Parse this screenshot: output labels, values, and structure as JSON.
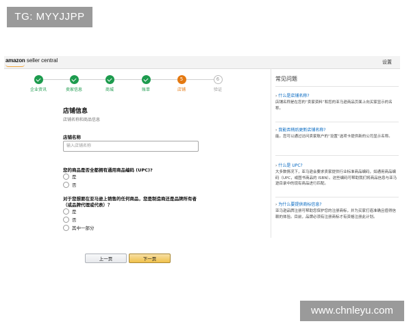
{
  "watermarks": {
    "top": "TG: MYYJJPP",
    "bottom": "www.chnleyu.com"
  },
  "header": {
    "logo_bold": "amazon",
    "logo_rest": " seller central",
    "settings": "设置"
  },
  "steps": [
    {
      "label": "企业资讯",
      "state": "done",
      "number": "1"
    },
    {
      "label": "卖家信息",
      "state": "done",
      "number": "2"
    },
    {
      "label": "商城",
      "state": "done",
      "number": "3"
    },
    {
      "label": "账单",
      "state": "done",
      "number": "4"
    },
    {
      "label": "店铺",
      "state": "current",
      "number": "5"
    },
    {
      "label": "验证",
      "state": "todo",
      "number": "6"
    }
  ],
  "form": {
    "title": "店铺信息",
    "subtitle": "店铺名称和商品信息",
    "store_name_label": "店铺名称",
    "store_name_placeholder": "输入店铺名称",
    "upc_question": "您的商品是否全都拥有通用商品编码 (UPC)?",
    "upc_options": [
      "是",
      "否"
    ],
    "brand_question_line1": "对于您想要在亚马逊上销售的任何商品，您是制造商还是品牌所有者",
    "brand_question_line2": "（或品牌代理或代表）？",
    "brand_options": [
      "是",
      "否",
      "其中一部分"
    ]
  },
  "faq": {
    "title": "常见问题",
    "items": [
      {
        "q": "什么是店铺名称?",
        "a": "店铺名称是在您的“卖家资料”和您的亚马逊商品页面上向买家显示的名称。"
      },
      {
        "q": "我能否稍后更新店铺名称?",
        "a": "能。您可以通过访问卖家账户的“设置”选项卡提供新的公司显示名称。"
      },
      {
        "q": "什么是 UPC?",
        "a": "大多数情况下，亚马逊会要求卖家提供行业标准商品编码，如通用商品编码（UPC，或图书商品的 ISBN）。这些编码可帮助我们将商品信息与亚马逊目录中的现有商品进行匹配。"
      },
      {
        "q": "为什么要提供商标信息?",
        "a": "亚马逊品牌注册可帮助您保护您的注册商标，并为买家打造准确且值得信赖的体验。目前，品牌必须有注册商标才有资格注册此计划。"
      }
    ]
  },
  "buttons": {
    "prev": "上一页",
    "next": "下一页"
  },
  "colors": {
    "done": "#1d9b4e",
    "current": "#e47911",
    "link": "#0066c0"
  }
}
